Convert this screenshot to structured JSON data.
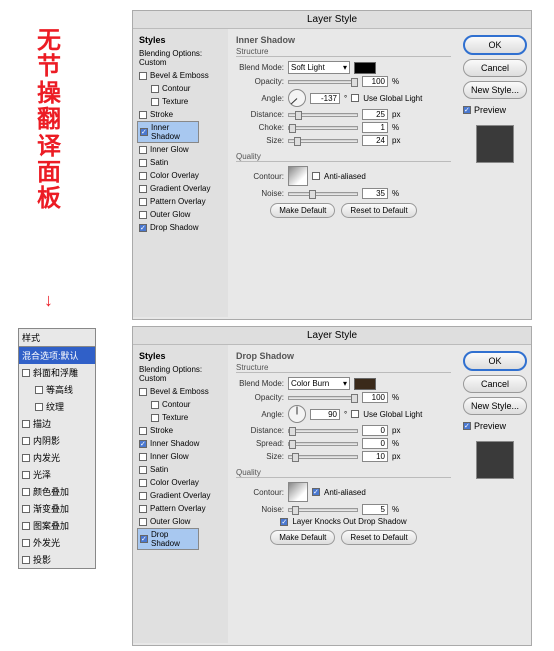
{
  "red_text": "无节操翻译面板",
  "zh_panel": {
    "title": "样式",
    "blend": "混合选项:默认",
    "items": [
      "斜面和浮雕",
      "等高线",
      "纹理",
      "描边",
      "内阴影",
      "内发光",
      "光泽",
      "颜色叠加",
      "渐变叠加",
      "图案叠加",
      "外发光",
      "投影"
    ]
  },
  "dialog_title": "Layer Style",
  "styles_col": {
    "header": "Styles",
    "blend": "Blending Options: Custom",
    "items": [
      {
        "label": "Bevel & Emboss",
        "on": false
      },
      {
        "label": "Contour",
        "on": false,
        "sub": true
      },
      {
        "label": "Texture",
        "on": false,
        "sub": true
      },
      {
        "label": "Stroke",
        "on": false
      },
      {
        "label": "Inner Shadow",
        "on": true
      },
      {
        "label": "Inner Glow",
        "on": false
      },
      {
        "label": "Satin",
        "on": false
      },
      {
        "label": "Color Overlay",
        "on": false
      },
      {
        "label": "Gradient Overlay",
        "on": false
      },
      {
        "label": "Pattern Overlay",
        "on": false
      },
      {
        "label": "Outer Glow",
        "on": false
      },
      {
        "label": "Drop Shadow",
        "on": true
      }
    ]
  },
  "buttons": {
    "ok": "OK",
    "cancel": "Cancel",
    "new_style": "New Style...",
    "preview": "Preview",
    "make_default": "Make Default",
    "reset_default": "Reset to Default"
  },
  "labels": {
    "inner_shadow": "Inner Shadow",
    "drop_shadow": "Drop Shadow",
    "structure": "Structure",
    "quality": "Quality",
    "blend_mode": "Blend Mode:",
    "opacity": "Opacity:",
    "angle": "Angle:",
    "use_global": "Use Global Light",
    "distance": "Distance:",
    "choke": "Choke:",
    "spread": "Spread:",
    "size": "Size:",
    "contour": "Contour:",
    "anti_aliased": "Anti-aliased",
    "noise": "Noise:",
    "px": "px",
    "pct": "%",
    "deg": "°",
    "layer_knocks": "Layer Knocks Out Drop Shadow"
  },
  "inner_shadow": {
    "blend_mode": "Soft Light",
    "opacity": 100,
    "angle": -137,
    "use_global": false,
    "distance": 25,
    "choke": 1,
    "size": 24,
    "anti_aliased": false,
    "noise": 35,
    "color": "#000000"
  },
  "drop_shadow": {
    "blend_mode": "Color Burn",
    "opacity": 100,
    "angle": 90,
    "use_global": false,
    "distance": 0,
    "spread": 0,
    "size": 10,
    "anti_aliased": true,
    "noise": 5,
    "layer_knocks": true,
    "color": "#3a2a1a"
  }
}
